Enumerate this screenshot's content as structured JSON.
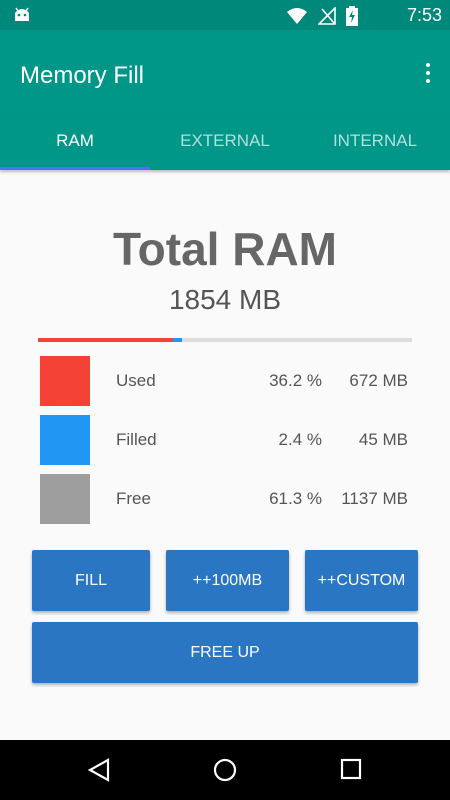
{
  "status_bar": {
    "time": "7:53",
    "icons": [
      "android-icon",
      "wifi-icon",
      "no-signal-icon",
      "battery-charging-icon"
    ]
  },
  "app_bar": {
    "title": "Memory Fill",
    "menu_icon": "more-vert-icon"
  },
  "tabs": [
    {
      "label": "RAM",
      "active": true
    },
    {
      "label": "EXTERNAL",
      "active": false
    },
    {
      "label": "INTERNAL",
      "active": false
    }
  ],
  "summary": {
    "heading": "Total RAM",
    "total": "1854 MB",
    "usage_bar": {
      "used_fraction": 0.362,
      "filled_fraction": 0.024
    }
  },
  "legend": [
    {
      "label": "Used",
      "percent": "36.2 %",
      "size": "672 MB",
      "color": "#f44336"
    },
    {
      "label": "Filled",
      "percent": "2.4 %",
      "size": "45 MB",
      "color": "#2196f3"
    },
    {
      "label": "Free",
      "percent": "61.3 %",
      "size": "1137 MB",
      "color": "#9e9e9e"
    }
  ],
  "buttons": {
    "fill": "FILL",
    "plus100": "++100MB",
    "plus_custom": "++CUSTOM",
    "free_up": "FREE UP"
  },
  "colors": {
    "primary": "#009688",
    "primary_dark": "#00897b",
    "accent": "#536dfe",
    "button": "#2a76c2"
  }
}
